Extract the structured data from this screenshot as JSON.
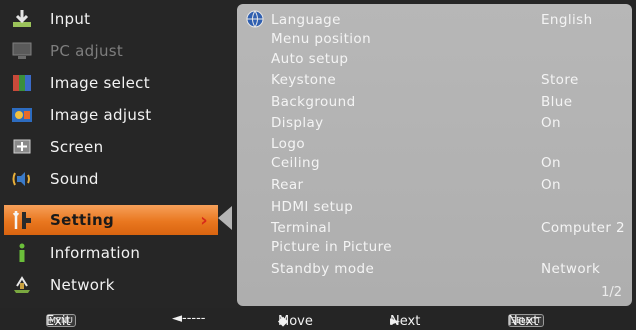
{
  "menu": {
    "items": [
      {
        "label": "Input",
        "icon": "input-icon",
        "disabled": false
      },
      {
        "label": "PC adjust",
        "icon": "pc-adjust-icon",
        "disabled": true
      },
      {
        "label": "Image select",
        "icon": "image-select-icon",
        "disabled": false
      },
      {
        "label": "Image adjust",
        "icon": "image-adjust-icon",
        "disabled": false
      },
      {
        "label": "Screen",
        "icon": "screen-icon",
        "disabled": false
      },
      {
        "label": "Sound",
        "icon": "sound-icon",
        "disabled": false
      },
      {
        "label": "Setting",
        "icon": "setting-icon",
        "disabled": false,
        "selected": true
      },
      {
        "label": "Information",
        "icon": "information-icon",
        "disabled": false
      },
      {
        "label": "Network",
        "icon": "network-icon",
        "disabled": false
      }
    ],
    "selected_arrow": "›"
  },
  "settings": {
    "rows": [
      {
        "label": "Language",
        "value": "English"
      },
      {
        "label": "Menu position",
        "value": ""
      },
      {
        "label": "Auto setup",
        "value": ""
      },
      {
        "label": "Keystone",
        "value": "Store"
      },
      {
        "label": "Background",
        "value": "Blue"
      },
      {
        "label": "Display",
        "value": "On"
      },
      {
        "label": "Logo",
        "value": ""
      },
      {
        "label": "Ceiling",
        "value": "On"
      },
      {
        "label": "Rear",
        "value": "On"
      },
      {
        "label": "HDMI setup",
        "value": ""
      },
      {
        "label": "Terminal",
        "value": "Computer 2"
      },
      {
        "label": "Picture in Picture",
        "value": ""
      },
      {
        "label": "Standby mode",
        "value": "Network"
      }
    ],
    "page": "1/2"
  },
  "footer": {
    "menu_key": "MENU",
    "exit_label": "Exit",
    "back_arrow": "◄-----",
    "move_label": "Move",
    "move_glyph": "◆",
    "next_glyph": "►",
    "next_label": "Next",
    "select_key": "SELECT",
    "select_next_label": "Next"
  },
  "colors": {
    "selected_item": "#e9771f",
    "panel_bg": "#b3b3b3",
    "arrow": "#d72a1a"
  }
}
